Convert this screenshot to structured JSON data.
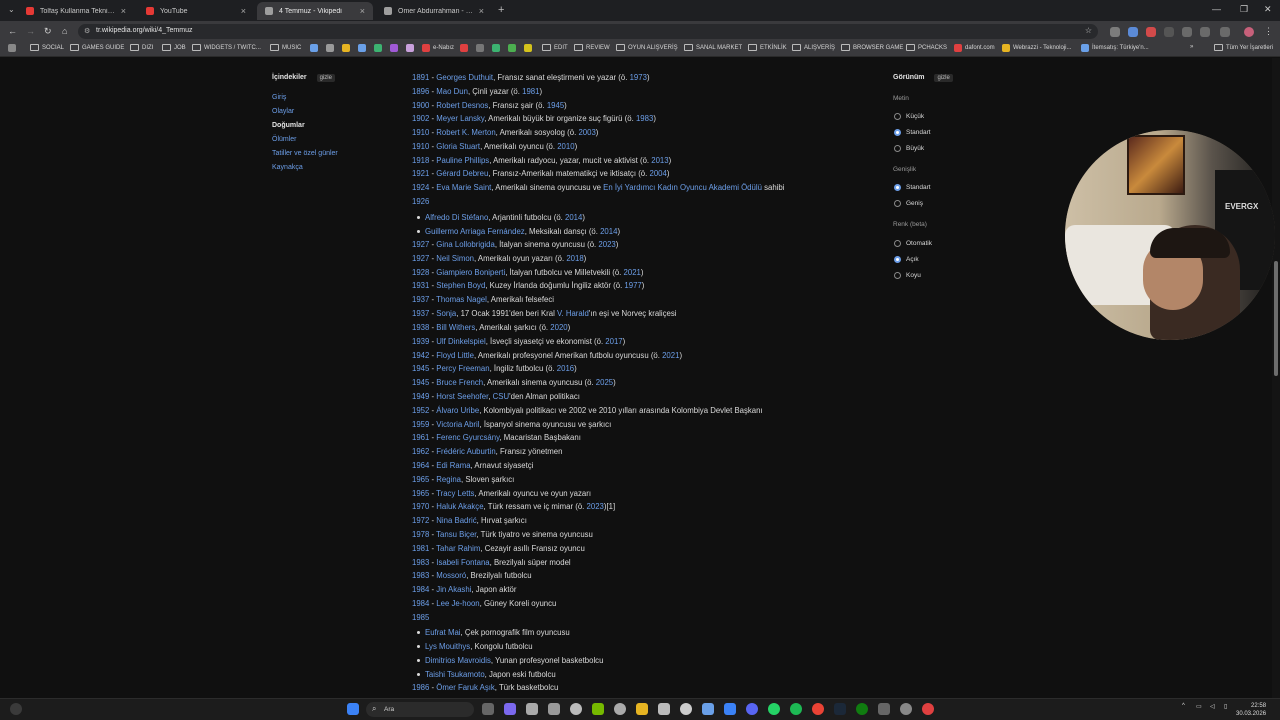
{
  "tabs": [
    {
      "title": "Tolfaş Kullanma Teknikleri - Bur...",
      "color": "#e53935",
      "active": false
    },
    {
      "title": "YouTube",
      "color": "#e53935",
      "active": false
    },
    {
      "title": "4 Temmuz - Vikipedi",
      "color": "#9e9e9e",
      "active": true
    },
    {
      "title": "Ömer Abdurrahman - Vikipedi",
      "color": "#9e9e9e",
      "active": false
    }
  ],
  "address": {
    "url": "tr.wikipedia.org/wiki/4_Temmuz"
  },
  "bookmarks": [
    {
      "label": "SOCIAL",
      "type": "folder"
    },
    {
      "label": "GAMES GUIDE",
      "type": "folder"
    },
    {
      "label": "DIZI",
      "type": "folder"
    },
    {
      "label": "JOB",
      "type": "folder"
    },
    {
      "label": "WIDGETS / TWITC...",
      "type": "folder"
    },
    {
      "label": "MUSIC",
      "type": "folder"
    },
    {
      "label": "e-Nabız",
      "type": "site"
    },
    {
      "label": "EDIT",
      "type": "folder"
    },
    {
      "label": "REVIEW",
      "type": "folder"
    },
    {
      "label": "OYUN ALIŞVERİŞ",
      "type": "folder"
    },
    {
      "label": "SANAL MARKET",
      "type": "folder"
    },
    {
      "label": "ETKİNLİK",
      "type": "folder"
    },
    {
      "label": "ALIŞVERİŞ",
      "type": "folder"
    },
    {
      "label": "BROWSER GAME",
      "type": "folder"
    },
    {
      "label": "PCHACKS",
      "type": "folder"
    },
    {
      "label": "dafont.com",
      "type": "site"
    },
    {
      "label": "Webrazzi - Teknoloji...",
      "type": "site"
    },
    {
      "label": "İtemsatış: Türkiye'n...",
      "type": "site"
    },
    {
      "label": "Tüm Yer İşaretleri",
      "type": "folder"
    }
  ],
  "toc": {
    "title": "İçindekiler",
    "hide": "gizle",
    "items": [
      "Giriş",
      "Olaylar",
      "Doğumlar",
      "Ölümler",
      "Tatiller ve özel günler",
      "Kaynakça"
    ],
    "current_index": 2
  },
  "appearance": {
    "title": "Görünüm",
    "hide": "gizle",
    "text_label": "Metin",
    "text_options": [
      "Küçük",
      "Standart",
      "Büyük"
    ],
    "text_selected": 1,
    "width_label": "Genişlik",
    "width_options": [
      "Standart",
      "Geniş"
    ],
    "width_selected": 0,
    "color_label": "Renk (beta)",
    "color_options": [
      "Otomatik",
      "Açık",
      "Koyu"
    ],
    "color_selected": 1
  },
  "births": [
    {
      "year": "1891",
      "name": "Georges Duthuit",
      "desc": ", Fransız sanat eleştirmeni ve yazar (ö. ",
      "death": "1973",
      "tail": ")"
    },
    {
      "year": "1896",
      "name": "Mao Dun",
      "desc": ", Çinli yazar (ö. ",
      "death": "1981",
      "tail": ")"
    },
    {
      "year": "1900",
      "name": "Robert Desnos",
      "desc": ", Fransız şair (ö. ",
      "death": "1945",
      "tail": ")"
    },
    {
      "year": "1902",
      "name": "Meyer Lansky",
      "desc": ", Amerikalı büyük bir organize suç figürü (ö. ",
      "death": "1983",
      "tail": ")"
    },
    {
      "year": "1910",
      "name": "Robert K. Merton",
      "desc": ", Amerikalı sosyolog (ö. ",
      "death": "2003",
      "tail": ")"
    },
    {
      "year": "1910",
      "name": "Gloria Stuart",
      "desc": ", Amerikalı oyuncu (ö. ",
      "death": "2010",
      "tail": ")"
    },
    {
      "year": "1918",
      "name": "Pauline Phillips",
      "desc": ", Amerikalı radyocu, yazar, mucit ve aktivist (ö. ",
      "death": "2013",
      "tail": ")"
    },
    {
      "year": "1921",
      "name": "Gérard Debreu",
      "desc": ", Fransız-Amerikalı matematikçi ve iktisatçı (ö. ",
      "death": "2004",
      "tail": ")"
    },
    {
      "year": "1924",
      "name": "Eva Marie Saint",
      "desc": ", Amerikalı sinema oyuncusu ve ",
      "death": "En İyi Yardımcı Kadın Oyuncu Akademi Ödülü",
      "tail": " sahibi"
    },
    {
      "year": "1926",
      "name": "",
      "desc": "",
      "death": "",
      "tail": ""
    },
    {
      "year": "",
      "name": "Alfredo Di Stéfano",
      "desc": ", Arjantinli futbolcu (ö. ",
      "death": "2014",
      "tail": ")",
      "sub": true
    },
    {
      "year": "",
      "name": "Guillermo Arriaga Fernández",
      "desc": ", Meksikalı dansçı (ö. ",
      "death": "2014",
      "tail": ")",
      "sub": true
    },
    {
      "year": "1927",
      "name": "Gina Lollobrigida",
      "desc": ", İtalyan sinema oyuncusu (ö. ",
      "death": "2023",
      "tail": ")"
    },
    {
      "year": "1927",
      "name": "Neil Simon",
      "desc": ", Amerikalı oyun yazarı (ö. ",
      "death": "2018",
      "tail": ")"
    },
    {
      "year": "1928",
      "name": "Giampiero Boniperti",
      "desc": ", İtalyan futbolcu ve Milletvekili (ö. ",
      "death": "2021",
      "tail": ")"
    },
    {
      "year": "1931",
      "name": "Stephen Boyd",
      "desc": ", Kuzey İrlanda doğumlu İngiliz aktör (ö. ",
      "death": "1977",
      "tail": ")"
    },
    {
      "year": "1937",
      "name": "Thomas Nagel",
      "desc": ", Amerikalı felsefeci",
      "death": "",
      "tail": ""
    },
    {
      "year": "1937",
      "name": "Sonja",
      "desc": ", 17 Ocak 1991'den beri Kral ",
      "death": "V. Harald",
      "tail": "'ın eşi ve Norveç kraliçesi"
    },
    {
      "year": "1938",
      "name": "Bill Withers",
      "desc": ", Amerikalı şarkıcı (ö. ",
      "death": "2020",
      "tail": ")"
    },
    {
      "year": "1939",
      "name": "Ulf Dinkelspiel",
      "desc": ", İsveçli siyasetçi ve ekonomist (ö. ",
      "death": "2017",
      "tail": ")"
    },
    {
      "year": "1942",
      "name": "Floyd Little",
      "desc": ", Amerikalı profesyonel Amerikan futbolu oyuncusu (ö. ",
      "death": "2021",
      "tail": ")"
    },
    {
      "year": "1945",
      "name": "Percy Freeman",
      "desc": ", İngiliz futbolcu (ö. ",
      "death": "2016",
      "tail": ")"
    },
    {
      "year": "1945",
      "name": "Bruce French",
      "desc": ", Amerikalı sinema oyuncusu (ö. ",
      "death": "2025",
      "tail": ")"
    },
    {
      "year": "1949",
      "name": "Horst Seehofer",
      "desc": ", ",
      "death": "CSU",
      "tail": "'den Alman politikacı"
    },
    {
      "year": "1952",
      "name": "Álvaro Uribe",
      "desc": ", Kolombiyalı politikacı ve 2002 ve 2010 yılları arasında Kolombiya Devlet Başkanı",
      "death": "",
      "tail": ""
    },
    {
      "year": "1959",
      "name": "Victoria Abril",
      "desc": ", İspanyol sinema oyuncusu ve şarkıcı",
      "death": "",
      "tail": ""
    },
    {
      "year": "1961",
      "name": "Ferenc Gyurcsány",
      "desc": ", Macaristan Başbakanı",
      "death": "",
      "tail": ""
    },
    {
      "year": "1962",
      "name": "Frédéric Auburtin",
      "desc": ", Fransız yönetmen",
      "death": "",
      "tail": ""
    },
    {
      "year": "1964",
      "name": "Edi Rama",
      "desc": ", Arnavut siyasetçi",
      "death": "",
      "tail": ""
    },
    {
      "year": "1965",
      "name": "Regina",
      "desc": ", Sloven şarkıcı",
      "death": "",
      "tail": ""
    },
    {
      "year": "1965",
      "name": "Tracy Letts",
      "desc": ", Amerikalı oyuncu ve oyun yazarı",
      "death": "",
      "tail": ""
    },
    {
      "year": "1970",
      "name": "Haluk Akakçe",
      "desc": ", Türk ressam ve iç mimar (ö. ",
      "death": "2023",
      "tail": ")[1]"
    },
    {
      "year": "1972",
      "name": "Nina Badrić",
      "desc": ", Hırvat şarkıcı",
      "death": "",
      "tail": ""
    },
    {
      "year": "1978",
      "name": "Tansu Biçer",
      "desc": ", Türk tiyatro ve sinema oyuncusu",
      "death": "",
      "tail": ""
    },
    {
      "year": "1981",
      "name": "Tahar Rahim",
      "desc": ", Cezayir asıllı Fransız oyuncu",
      "death": "",
      "tail": ""
    },
    {
      "year": "1983",
      "name": "Isabeli Fontana",
      "desc": ", Brezilyalı süper model",
      "death": "",
      "tail": ""
    },
    {
      "year": "1983",
      "name": "Mossoró",
      "desc": ", Brezilyalı futbolcu",
      "death": "",
      "tail": ""
    },
    {
      "year": "1984",
      "name": "Jin Akashi",
      "desc": ", Japon aktör",
      "death": "",
      "tail": ""
    },
    {
      "year": "1984",
      "name": "Lee Je-hoon",
      "desc": ", Güney Koreli oyuncu",
      "death": "",
      "tail": ""
    },
    {
      "year": "1985",
      "name": "",
      "desc": "",
      "death": "",
      "tail": ""
    },
    {
      "year": "",
      "name": "Eufrat Mai",
      "desc": ", Çek pornografik film oyuncusu",
      "death": "",
      "tail": "",
      "sub": true
    },
    {
      "year": "",
      "name": "Lys Mouithys",
      "desc": ", Kongolu futbolcu",
      "death": "",
      "tail": "",
      "sub": true
    },
    {
      "year": "",
      "name": "Dimitrios Mavroidis",
      "desc": ", Yunan profesyonel basketbolcu",
      "death": "",
      "tail": "",
      "sub": true
    },
    {
      "year": "",
      "name": "Taishi Tsukamoto",
      "desc": ", Japon eski futbolcu",
      "death": "",
      "tail": "",
      "sub": true
    },
    {
      "year": "1986",
      "name": "Ömer Faruk Aşık",
      "desc": ", Türk basketbolcu",
      "death": "",
      "tail": ""
    }
  ],
  "webcam": {
    "chair_text": "EVERGX"
  },
  "taskbar": {
    "search_placeholder": "Ara",
    "time": "22:58",
    "date": "30.03.2026"
  }
}
